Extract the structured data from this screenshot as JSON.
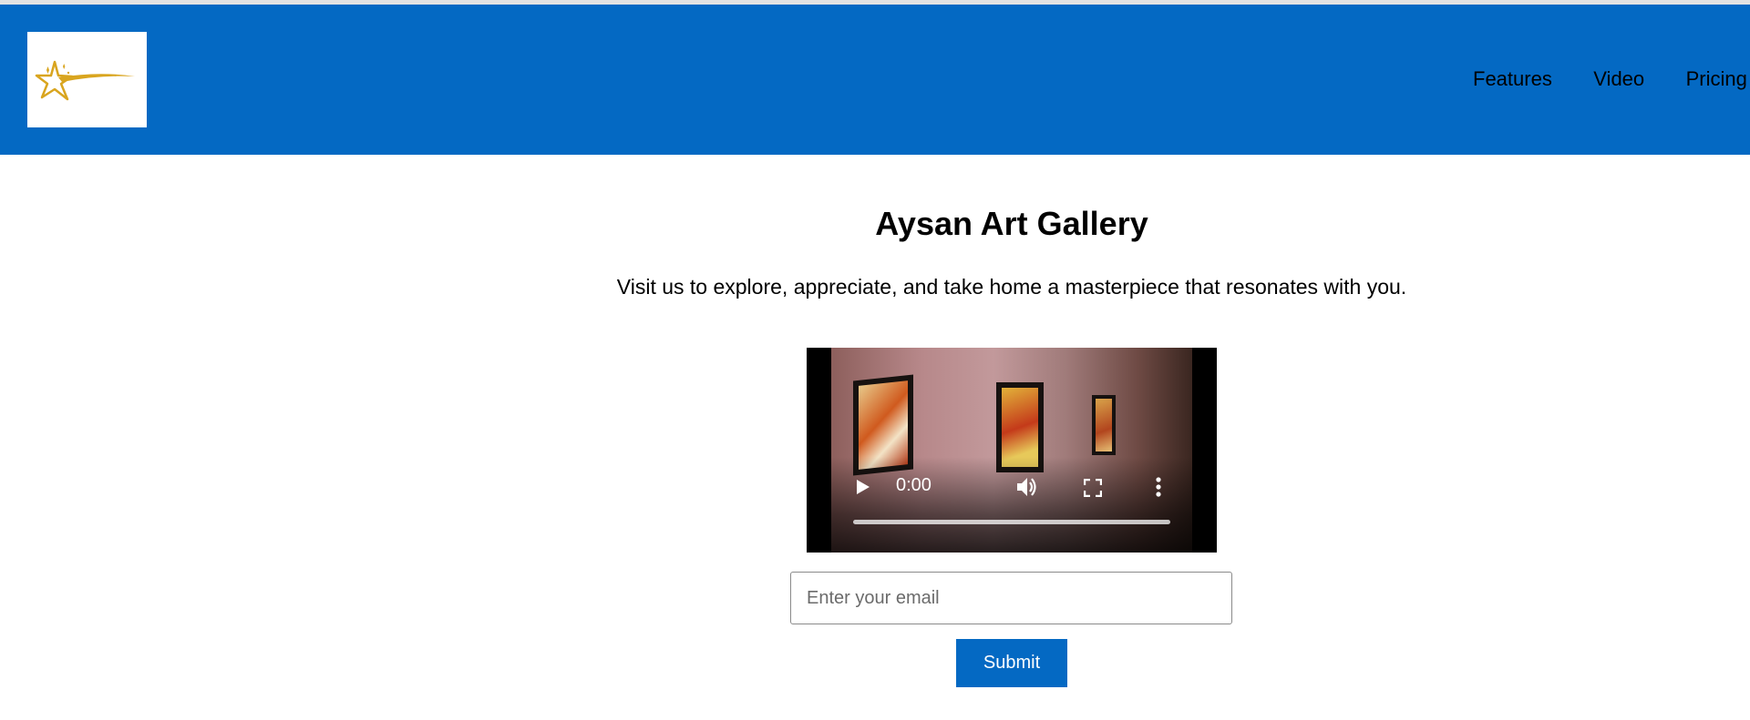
{
  "colors": {
    "header_bg": "#0469c3",
    "logo_accent": "#d9a51f",
    "button_bg": "#0469c3"
  },
  "header": {
    "logo_icon": "shooting-star-logo",
    "nav": [
      {
        "label": "Features"
      },
      {
        "label": "Video"
      },
      {
        "label": "Pricing"
      }
    ]
  },
  "hero": {
    "title": "Aysan Art Gallery",
    "subtitle": "Visit us to explore, appreciate, and take home a masterpiece that resonates with you."
  },
  "video": {
    "time": "0:00",
    "progress": 0,
    "icons": [
      "play-icon",
      "volume-icon",
      "fullscreen-icon",
      "more-options-icon"
    ]
  },
  "form": {
    "email_placeholder": "Enter your email",
    "email_value": "",
    "submit_label": "Submit"
  }
}
